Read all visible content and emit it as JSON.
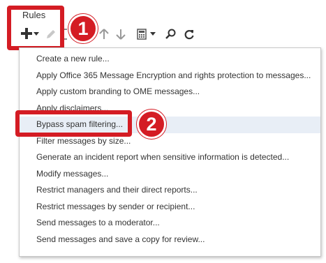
{
  "header": {
    "title": "Rules"
  },
  "toolbar": {
    "icons": [
      "plus-icon",
      "chevron-down-icon",
      "pencil-icon",
      "arrow-up-icon",
      "arrow-down-icon",
      "calculator-icon",
      "search-icon",
      "refresh-icon"
    ]
  },
  "callouts": {
    "step1": "1",
    "step2": "2"
  },
  "colors": {
    "callout": "#d41c24",
    "highlight_row": "#e8eef6"
  },
  "menu": {
    "items": [
      {
        "label": "Create a new rule...",
        "highlighted": false
      },
      {
        "label": "Apply Office 365 Message Encryption and rights protection to messages...",
        "highlighted": false
      },
      {
        "label": "Apply custom branding to OME messages...",
        "highlighted": false
      },
      {
        "label": "Apply disclaimers...",
        "highlighted": false
      },
      {
        "label": "Bypass spam filtering...",
        "highlighted": true
      },
      {
        "label": "Filter messages by size...",
        "highlighted": false
      },
      {
        "label": "Generate an incident report when sensitive information is detected...",
        "highlighted": false
      },
      {
        "label": "Modify messages...",
        "highlighted": false
      },
      {
        "label": "Restrict managers and their direct reports...",
        "highlighted": false
      },
      {
        "label": "Restrict messages by sender or recipient...",
        "highlighted": false
      },
      {
        "label": "Send messages to a moderator...",
        "highlighted": false
      },
      {
        "label": "Send messages and save a copy for review...",
        "highlighted": false
      }
    ]
  }
}
